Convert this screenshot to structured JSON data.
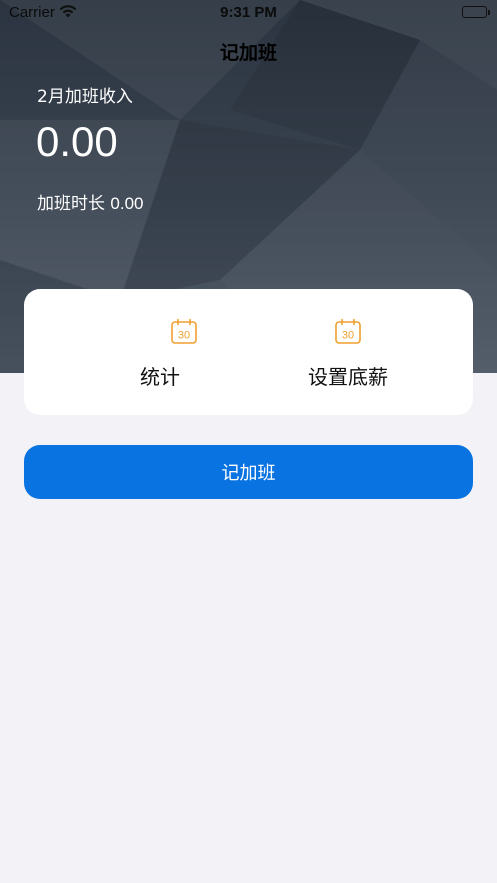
{
  "status_bar": {
    "carrier": "Carrier",
    "time": "9:31 PM"
  },
  "nav": {
    "title": "记加班"
  },
  "summary": {
    "income_label": "2月加班收入",
    "income_value": "0.00",
    "duration_label": "加班时长",
    "duration_value": "0.00"
  },
  "actions": [
    {
      "label": "统计",
      "icon": "calendar-30-icon"
    },
    {
      "label": "设置底薪",
      "icon": "calendar-30-icon"
    }
  ],
  "icon_text": "30",
  "primary_button": {
    "label": "记加班"
  },
  "colors": {
    "accent": "#0a73e2",
    "icon": "#f0a030",
    "header_bg": "#2e3743",
    "page_bg": "#f2f2f7"
  }
}
